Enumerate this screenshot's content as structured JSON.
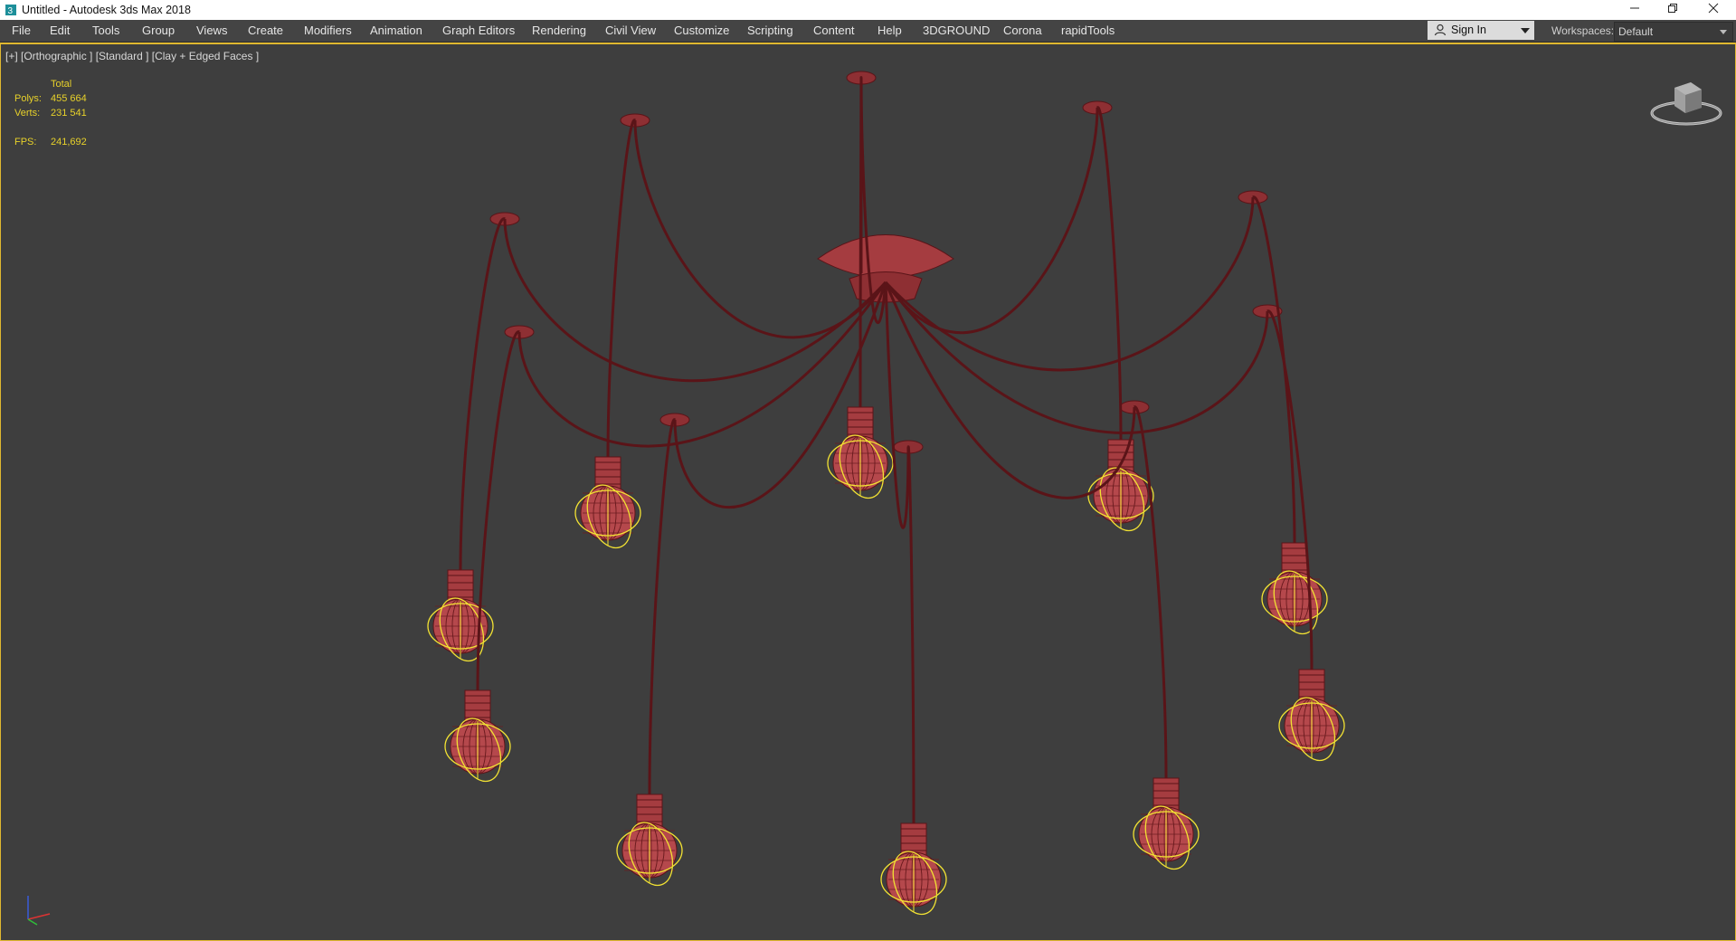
{
  "window": {
    "title": "Untitled - Autodesk 3ds Max 2018",
    "controls": [
      "minimize",
      "restore",
      "close"
    ]
  },
  "menu": {
    "items": [
      "File",
      "Edit",
      "Tools",
      "Group",
      "Views",
      "Create",
      "Modifiers",
      "Animation",
      "Graph Editors",
      "Rendering",
      "Civil View",
      "Customize",
      "Scripting",
      "Content",
      "Help",
      "3DGROUND",
      "Corona",
      "rapidTools"
    ]
  },
  "account": {
    "signin_label": "Sign In",
    "icon": "user-icon"
  },
  "workspaces": {
    "label": "Workspaces:",
    "value": "Default"
  },
  "viewport": {
    "label": "[+] [Orthographic ] [Standard ] [Clay + Edged Faces ]",
    "stats": {
      "header": "Total",
      "polys_label": "Polys:",
      "polys_value": "455 664",
      "verts_label": "Verts:",
      "verts_value": "231 541",
      "fps_label": "FPS:",
      "fps_value": "241,692"
    },
    "colors": {
      "wire": "#5a1418",
      "bulb": "#b5484c",
      "selection": "#f2e233",
      "border": "#e0b830"
    }
  }
}
